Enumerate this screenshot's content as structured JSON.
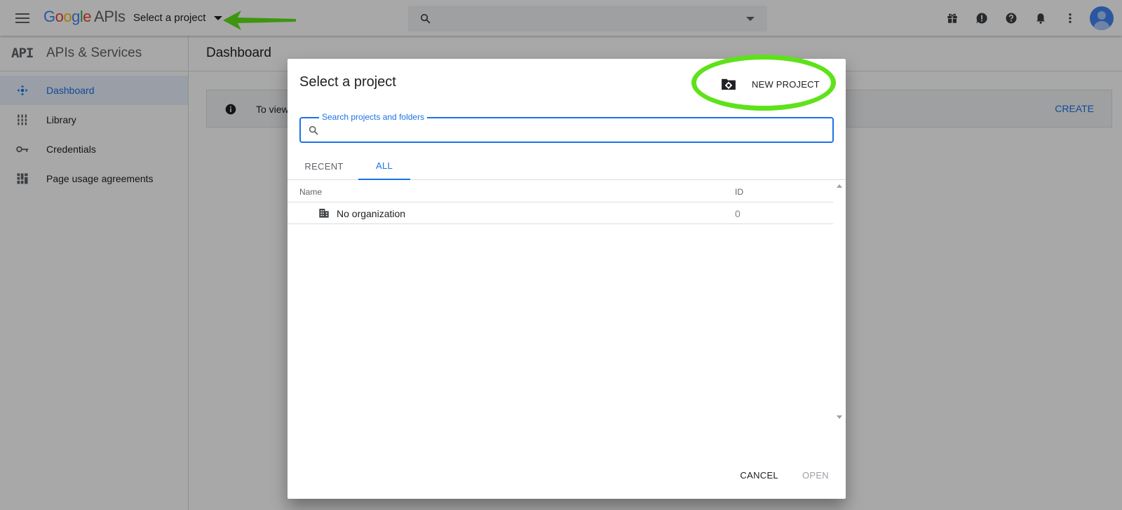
{
  "header": {
    "logo_google": [
      "G",
      "o",
      "o",
      "g",
      "l",
      "e"
    ],
    "logo_apis": "APIs",
    "project_picker_label": "Select a project",
    "search_placeholder": ""
  },
  "sidebar": {
    "logo_text": "API",
    "title": "APIs & Services",
    "items": [
      {
        "label": "Dashboard",
        "icon": "dashboard-icon",
        "active": true
      },
      {
        "label": "Library",
        "icon": "library-icon",
        "active": false
      },
      {
        "label": "Credentials",
        "icon": "key-icon",
        "active": false
      },
      {
        "label": "Page usage agreements",
        "icon": "agreements-icon",
        "active": false
      }
    ]
  },
  "main": {
    "title": "Dashboard",
    "banner_text": "To view",
    "banner_action": "CREATE"
  },
  "dialog": {
    "title": "Select a project",
    "new_project_label": "NEW PROJECT",
    "search_label": "Search projects and folders",
    "search_value": "",
    "tabs": [
      {
        "label": "RECENT",
        "active": false
      },
      {
        "label": "ALL",
        "active": true
      }
    ],
    "columns": {
      "name": "Name",
      "id": "ID"
    },
    "rows": [
      {
        "name": "No organization",
        "id": "0",
        "icon": "building-icon"
      }
    ],
    "cancel_label": "CANCEL",
    "open_label": "OPEN"
  },
  "colors": {
    "accent": "#1a73e8",
    "annotation_green": "#5ee21a",
    "scrim": "rgba(0,0,0,0.34)"
  }
}
